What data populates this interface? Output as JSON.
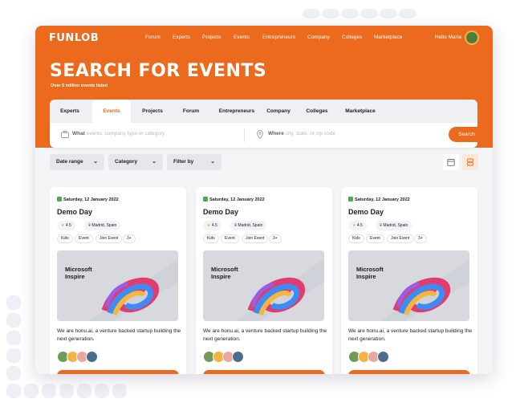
{
  "app": {
    "logo": "FUNLOB",
    "greeting": "Hello Maria"
  },
  "nav": [
    "Forum",
    "Experts",
    "Projects",
    "Events",
    "Entrepreneurs",
    "Company",
    "Colleges",
    "Marketplace"
  ],
  "hero": {
    "title": "SEARCH FOR EVENTS",
    "subtitle": "Over 5 million events listed"
  },
  "tabs": [
    "Experts",
    "Events",
    "Projects",
    "Forum",
    "Entrepreneurs",
    "Company",
    "Colleges",
    "Marketplace"
  ],
  "active_tab": "Events",
  "search": {
    "what_label": "What",
    "what_placeholder": "events, company type or category",
    "where_label": "Where",
    "where_placeholder": "city, state, or zip code",
    "button": "Search"
  },
  "filters": [
    "Date range",
    "Category",
    "Filter by"
  ],
  "icons": {
    "calendar_view": "calendar-icon",
    "list_view": "list-icon",
    "briefcase": "briefcase-icon",
    "location": "location-pin-icon",
    "star": "star-icon"
  },
  "colors": {
    "brand": "#ec6a1d",
    "date_icon": "#4caa4f"
  },
  "cards": [
    {
      "date": "Saturday, 12 January 2022",
      "title": "Demo Day",
      "rating": "4.5",
      "location": "Madrid, Spain",
      "tags": [
        "Kids",
        "Event",
        "Join Event",
        "3+"
      ],
      "banner_text": "Microsoft Inspire",
      "description": "We are honu.ai, a venture backed startup building the next generation."
    },
    {
      "date": "Saturday, 12 January 2022",
      "title": "Demo Day",
      "rating": "4.5",
      "location": "Madrid, Spain",
      "tags": [
        "Kids",
        "Event",
        "Join Event",
        "3+"
      ],
      "banner_text": "Microsoft Inspire",
      "description": "We are honu.ai, a venture backed startup building the next generation."
    },
    {
      "date": "Saturday, 12 January 2022",
      "title": "Demo Day",
      "rating": "4.5",
      "location": "Madrid, Spain",
      "tags": [
        "Kids",
        "Event",
        "Join Event",
        "3+"
      ],
      "banner_text": "Microsoft Inspire",
      "description": "We are honu.ai, a venture backed startup building the next generation."
    }
  ]
}
